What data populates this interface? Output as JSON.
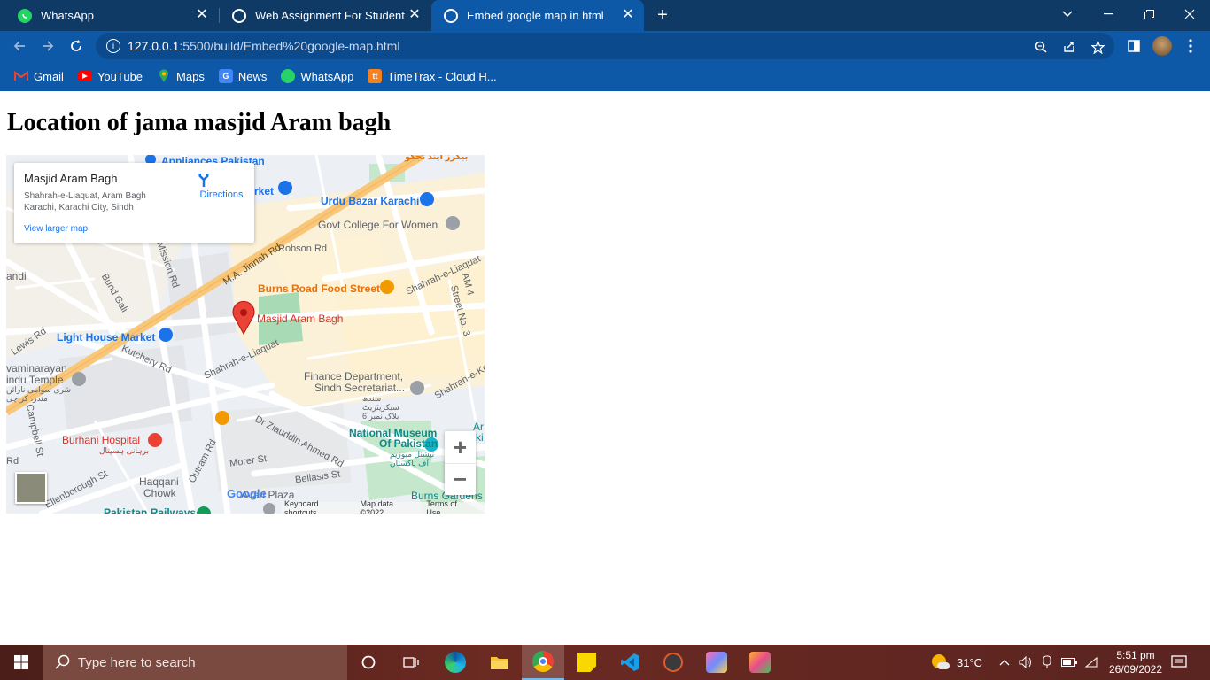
{
  "browser": {
    "tabs": [
      {
        "label": "WhatsApp",
        "icon": "whatsapp-icon"
      },
      {
        "label": "Web Assignment For Student",
        "icon": "globe-icon"
      },
      {
        "label": "Embed google map in html",
        "icon": "globe-icon",
        "active": true
      }
    ],
    "url_host": "127.0.0.1",
    "url_path": ":5500/build/Embed%20google-map.html",
    "bookmarks": [
      "Gmail",
      "YouTube",
      "Maps",
      "News",
      "WhatsApp",
      "TimeTrax - Cloud H..."
    ]
  },
  "page": {
    "heading": "Location of jama masjid Aram bagh"
  },
  "map": {
    "card_title": "Masjid Aram Bagh",
    "card_address_line1": "Shahrah-e-Liaquat, Aram Bagh",
    "card_address_line2": "Karachi, Karachi City, Sindh",
    "directions_label": "Directions",
    "larger_map_link": "View larger map",
    "labels": {
      "appliances": "Appliances Pakistan",
      "urdu_top": "بیکرز اینڈ تجکو",
      "market": "rket",
      "urdu_bazar": "Urdu Bazar Karachi",
      "govt_college": "Govt College For Women",
      "robson": "Robson Rd",
      "jinnah": "M.A. Jinnah Rd",
      "mission": "Mission Rd",
      "bund_gali": "Bund Gali",
      "burns_road": "Burns Road Food Street",
      "liaquat_ne": "Shahrah-e-Liaquat",
      "am4": "AM 4",
      "street3": "Street No. 3",
      "andi": "andi",
      "masjid": "Masjid Aram Bagh",
      "light_house": "Light House Market",
      "lewis": "Lewis Rd",
      "kutchery": "Kutchery Rd",
      "liaquat_mid": "Shahrah-e-Liaquat",
      "swaminarayan1": "vaminarayan",
      "swaminarayan2": "indu Temple",
      "urdu_temple": "شری سوامی نارائن مندر، کراچی",
      "finance1": "Finance Department,",
      "finance2": "Sindh Secretariat...",
      "urdu_finance": "سندھ سیکریٹریٹ بلاک نمبر 6",
      "liaquat_e": "Shahrah-e-Ke",
      "campbell": "Campbell St",
      "burhani": "Burhani Hospital",
      "urdu_burhani": "برہانی ہسپتال",
      "national_museum1": "National Museum",
      "national_museum2": "Of Pakistan",
      "urdu_museum": "نیشنل میوزیم آف پاکستان",
      "ziauddin": "Dr Ziauddin Ahmed Rd",
      "outram": "Outram Rd",
      "morer": "Morer St",
      "bellasis": "Bellasis St",
      "haqqani1": "Haqqani",
      "haqqani2": "Chowk",
      "ellenborough": "Ellenborough St",
      "avari": "Avari Plaza",
      "burns_gardens": "Burns Gardens",
      "railways": "Pakistan Railways",
      "ar": "Ar",
      "ki": "ki",
      "rd": "Rd"
    },
    "google_logo": "Google",
    "footer": [
      "Keyboard shortcuts",
      "Map data ©2022",
      "Terms of Use"
    ],
    "zoom_in": "+",
    "zoom_out": "−"
  },
  "taskbar": {
    "search_placeholder": "Type here to search",
    "temperature": "31°C",
    "time": "5:51 pm",
    "date": "26/09/2022"
  }
}
